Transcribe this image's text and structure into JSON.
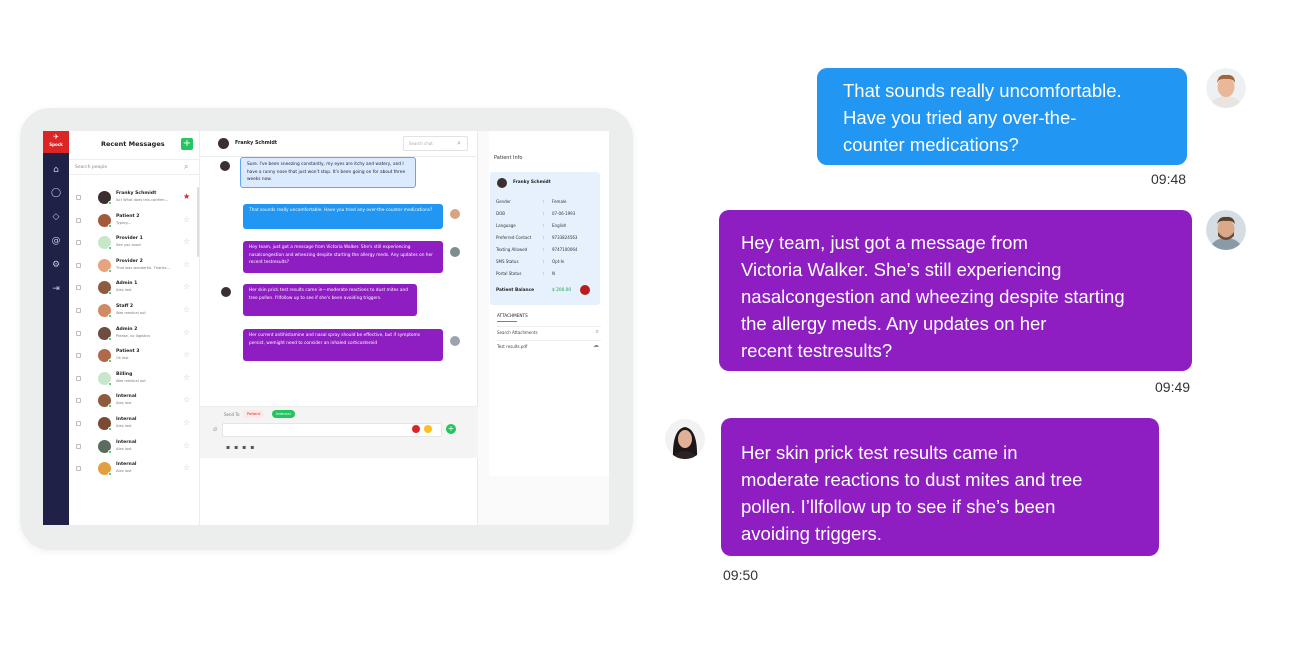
{
  "app": {
    "brand": "Spock",
    "list_title": "Recent Messages",
    "add_label": "+",
    "search_placeholder": "Search people"
  },
  "contacts": [
    {
      "name": "Franky Schmidt",
      "preview": "So! What does this confirm...",
      "starred": true
    },
    {
      "name": "Patient 2",
      "preview": "Typing...",
      "starred": false
    },
    {
      "name": "Provider 1",
      "preview": "See you soon!",
      "starred": false
    },
    {
      "name": "Provider 2",
      "preview": "That was wonderful. Thanks...",
      "starred": false
    },
    {
      "name": "Admin 1",
      "preview": "Alex lost",
      "starred": false
    },
    {
      "name": "Staff 2",
      "preview": "Was medical out",
      "starred": false
    },
    {
      "name": "Admin 2",
      "preview": "Please, no logistics",
      "starred": false
    },
    {
      "name": "Patient 3",
      "preview": "Ok lost",
      "starred": false
    },
    {
      "name": "Billing",
      "preview": "Was medical out",
      "starred": false
    },
    {
      "name": "Internal",
      "preview": "Alex lost",
      "starred": false
    },
    {
      "name": "Internal",
      "preview": "Alex lost",
      "starred": false
    },
    {
      "name": "Internal",
      "preview": "Alex lost",
      "starred": false
    },
    {
      "name": "Internal",
      "preview": "Alex lost",
      "starred": false
    }
  ],
  "chat": {
    "contact_name": "Franky Schmidt",
    "search_placeholder": "Search chat",
    "messages": [
      "Sure. I've been sneezing constantly, my eyes are itchy and watery, and I have a runny nose that just won't stop. It's been going on for about three weeks now.",
      "That sounds really uncomfortable. Have you tried any over-the-counter medications?",
      "Hey team, just got a message from Victoria Walker. She's still experiencing nasalcongestion and wheezing despite starting the allergy meds. Any updates on her recent testresults?",
      "Her skin prick test results came in—moderate reactions to dust mites and tree pollen. I'llfollow up to see if she's been avoiding triggers.",
      "Her current antihistamine and nasal spray should be effective, but if symptoms persist, wemight need to consider an inhaled corticosteroid"
    ],
    "send_to_label": "Send To",
    "tag_patient": "Patient",
    "tag_internal": "Internal"
  },
  "patient_info": {
    "title": "Patient Info",
    "name": "Franky Schmidt",
    "fields": [
      {
        "label": "Gender",
        "value": "Female"
      },
      {
        "label": "DOB",
        "value": "07-06-1993"
      },
      {
        "label": "Language",
        "value": "English"
      },
      {
        "label": "Preferred Contact",
        "value": "9733824563"
      },
      {
        "label": "Texting Allowed",
        "value": "9747100064"
      },
      {
        "label": "SMS Status",
        "value": "Opt-In"
      },
      {
        "label": "Portal Status",
        "value": "N"
      }
    ],
    "balance_label": "Patient Balance",
    "balance_value": "$ 200.00",
    "attachments_title": "ATTACHMENTS",
    "attachments": [
      "Search Attachments",
      "Test results.pdf"
    ]
  },
  "bubbles": {
    "b1": {
      "lines": [
        "That sounds really uncomfortable.",
        "Have you tried any over-the-",
        "counter medications?"
      ],
      "time": "09:48"
    },
    "b2": {
      "lines": [
        "Hey team, just got a message from",
        "Victoria Walker. She’s still experiencing",
        "nasalcongestion and wheezing despite starting",
        "the allergy meds. Any updates on her",
        "recent testresults?"
      ],
      "time": "09:49"
    },
    "b3": {
      "lines": [
        "Her skin prick test results came in",
        "moderate reactions to dust mites and tree",
        "pollen. I’llfollow up to see if she’s been",
        "avoiding triggers."
      ],
      "time": "09:50"
    }
  },
  "colors": {
    "blue_bubble": "#2196f3",
    "purple_bubble": "#8e1ec1",
    "rail": "#1f2246",
    "brand_red": "#dc2626",
    "accent_green": "#22c55e"
  }
}
